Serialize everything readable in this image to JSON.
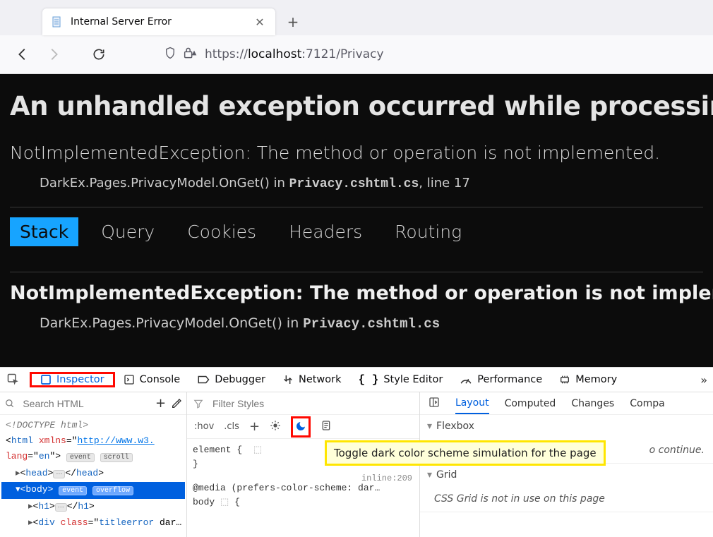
{
  "tab": {
    "title": "Internal Server Error"
  },
  "url": {
    "protocol": "https://",
    "host": "localhost",
    "port": ":7121",
    "path": "/Privacy"
  },
  "page": {
    "heading": "An unhandled exception occurred while processing the",
    "exception_summary": "NotImplementedException: The method or operation is not implemented.",
    "stack_prefix": "DarkEx.Pages.PrivacyModel.OnGet() in ",
    "stack_file": "Privacy.cshtml.cs",
    "stack_line": ", line 17",
    "tabs": {
      "stack": "Stack",
      "query": "Query",
      "cookies": "Cookies",
      "headers": "Headers",
      "routing": "Routing"
    },
    "exception_title2": "NotImplementedException: The method or operation is not implemented.",
    "stack2_prefix": "DarkEx.Pages.PrivacyModel.OnGet() in ",
    "stack2_file": "Privacy.cshtml.cs"
  },
  "devtools": {
    "tabs": {
      "inspector": "Inspector",
      "console": "Console",
      "debugger": "Debugger",
      "network": "Network",
      "style_editor": "Style Editor",
      "performance": "Performance",
      "memory": "Memory"
    },
    "search_placeholder": "Search HTML",
    "filter_placeholder": "Filter Styles",
    "hov": ":hov",
    "cls": ".cls",
    "dom": {
      "doctype": "<!DOCTYPE html>",
      "html_open": "html",
      "xmlns": "xmlns",
      "xmlns_val": "http://www.w3.",
      "lang": "lang",
      "lang_val": "en",
      "event": "event",
      "scroll": "scroll",
      "head": "head",
      "body": "body",
      "overflow": "overflow",
      "h1": "h1",
      "div": "div",
      "class": "class",
      "titleerror": "titleerror"
    },
    "styles": {
      "element_open": "element {",
      "close": "}",
      "media": "@media (prefers-color-scheme: dar…",
      "body_open": "body",
      "inline_label": "inline:209"
    },
    "tooltip": "Toggle dark color scheme simulation for the page",
    "right_tabs": {
      "layout": "Layout",
      "computed": "Computed",
      "changes": "Changes",
      "compat": "Compa"
    },
    "flexbox": {
      "title": "Flexbox",
      "body_suffix": "o continue."
    },
    "grid": {
      "title": "Grid",
      "body": "CSS Grid is not in use on this page"
    }
  }
}
